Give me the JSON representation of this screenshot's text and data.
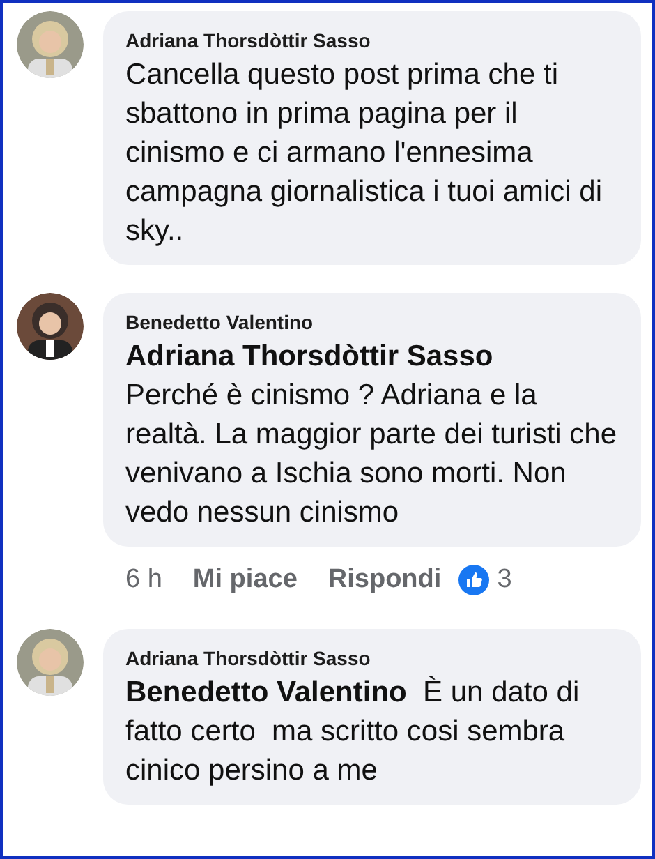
{
  "comments": [
    {
      "author": "Adriana Thorsdòttir Sasso",
      "text": "Cancella questo post prima che ti sbattono in prima pagina per il cinismo e ci armano l'ennesima campagna giornalistica i tuoi amici di sky.."
    },
    {
      "author": "Benedetto Valentino",
      "mention": "Adriana Thorsdòttir Sasso",
      "kind": "block",
      "text": "Perché è cinismo ? Adriana e la realtà. La maggior parte dei turisti che venivano a Ischia sono morti. Non vedo nessun cinismo",
      "actions": {
        "time": "6 h",
        "like": "Mi piace",
        "reply": "Rispondi",
        "reaction_count": "3"
      }
    },
    {
      "author": "Adriana Thorsdòttir Sasso",
      "mention": "Benedetto Valentino",
      "kind": "inline",
      "text": "È un dato di fatto certo  ma scritto cosi sembra cinico persino a me"
    }
  ]
}
